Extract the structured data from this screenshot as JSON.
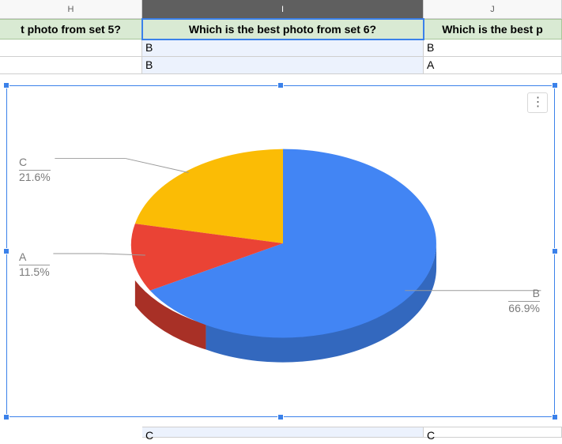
{
  "columns": {
    "H": "H",
    "I": "I",
    "J": "J"
  },
  "questions": {
    "H": "t photo from set 5?",
    "I": "Which is the best photo from set 6?",
    "J": "Which is the best p"
  },
  "rows": [
    {
      "H": "",
      "I": "B",
      "J": "B"
    },
    {
      "H": "",
      "I": "B",
      "J": "A"
    }
  ],
  "bottom_row": {
    "I": "C",
    "J": "C"
  },
  "chart_data": {
    "type": "pie",
    "title": "",
    "series": [
      {
        "name": "B",
        "value": 66.9,
        "color": "#4285f4"
      },
      {
        "name": "C",
        "value": 21.6,
        "color": "#fbbc05"
      },
      {
        "name": "A",
        "value": 11.5,
        "color": "#ea4335"
      }
    ],
    "labels": {
      "B": {
        "name": "B",
        "pct": "66.9%"
      },
      "C": {
        "name": "C",
        "pct": "21.6%"
      },
      "A": {
        "name": "A",
        "pct": "11.5%"
      }
    }
  }
}
